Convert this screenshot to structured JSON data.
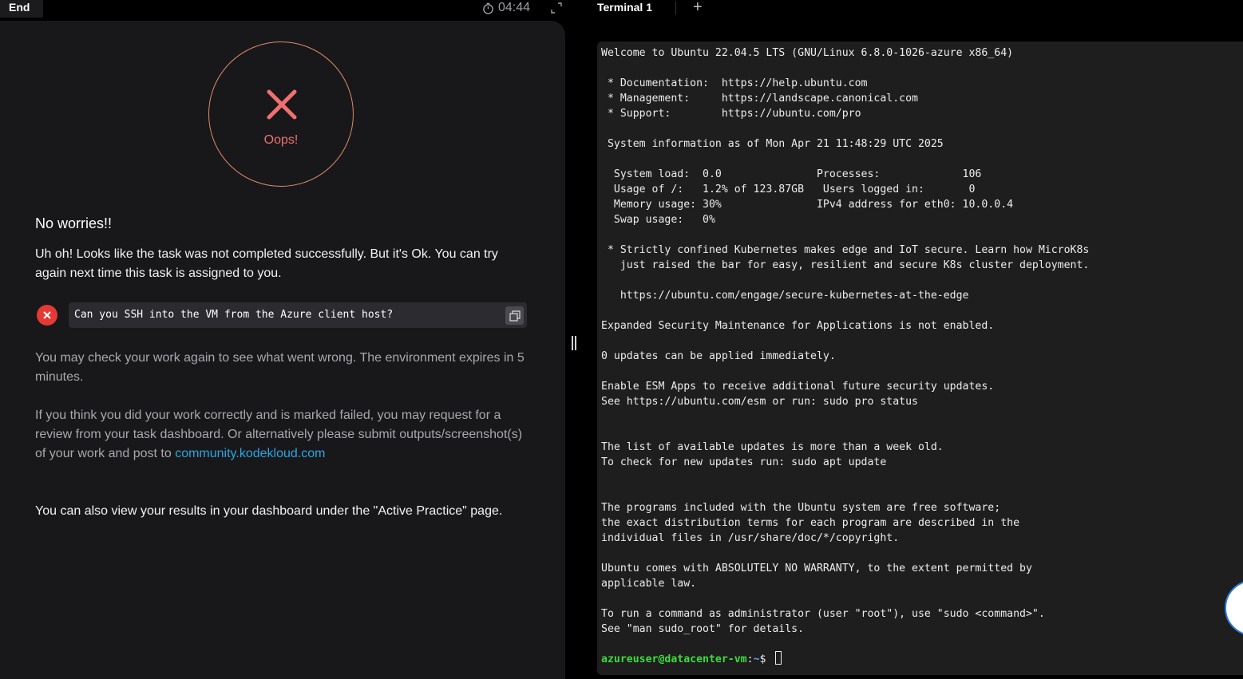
{
  "header": {
    "end_label": "End",
    "timer": "04:44"
  },
  "result": {
    "status_text": "Oops!",
    "colors": {
      "error": "#f07070",
      "ring": "#e08a6a"
    }
  },
  "message": {
    "title": "No worries!!",
    "body": "Uh oh! Looks like the task was not completed successfully. But it's Ok. You can try again next time this task is assigned to you.",
    "task_question": "Can you SSH into the VM from the Azure client host?",
    "check_again": "You may check your work again to see what went wrong. The environment expires in 5 minutes.",
    "review_prefix": "If you think you did your work correctly and is marked failed, you may request for a review from your task dashboard. Or alternatively please submit outputs/screenshot(s) of your work and post to ",
    "community_link": "community.kodekloud.com",
    "active_practice": "You can also view your results in your dashboard under the \"Active Practice\" page."
  },
  "terminal": {
    "tab_label": "Terminal 1",
    "add_tab": "+",
    "output": "Welcome to Ubuntu 22.04.5 LTS (GNU/Linux 6.8.0-1026-azure x86_64)\n\n * Documentation:  https://help.ubuntu.com\n * Management:     https://landscape.canonical.com\n * Support:        https://ubuntu.com/pro\n\n System information as of Mon Apr 21 11:48:29 UTC 2025\n\n  System load:  0.0               Processes:             106\n  Usage of /:   1.2% of 123.87GB   Users logged in:       0\n  Memory usage: 30%               IPv4 address for eth0: 10.0.0.4\n  Swap usage:   0%\n\n * Strictly confined Kubernetes makes edge and IoT secure. Learn how MicroK8s\n   just raised the bar for easy, resilient and secure K8s cluster deployment.\n\n   https://ubuntu.com/engage/secure-kubernetes-at-the-edge\n\nExpanded Security Maintenance for Applications is not enabled.\n\n0 updates can be applied immediately.\n\nEnable ESM Apps to receive additional future security updates.\nSee https://ubuntu.com/esm or run: sudo pro status\n\n\nThe list of available updates is more than a week old.\nTo check for new updates run: sudo apt update\n\n\nThe programs included with the Ubuntu system are free software;\nthe exact distribution terms for each program are described in the\nindividual files in /usr/share/doc/*/copyright.\n\nUbuntu comes with ABSOLUTELY NO WARRANTY, to the extent permitted by\napplicable law.\n\nTo run a command as administrator (user \"root\"), use \"sudo <command>\".\nSee \"man sudo_root\" for details.",
    "prompt_user": "azureuser@datacenter-vm",
    "prompt_sep": ":",
    "prompt_path": "~",
    "prompt_symbol": "$ "
  }
}
